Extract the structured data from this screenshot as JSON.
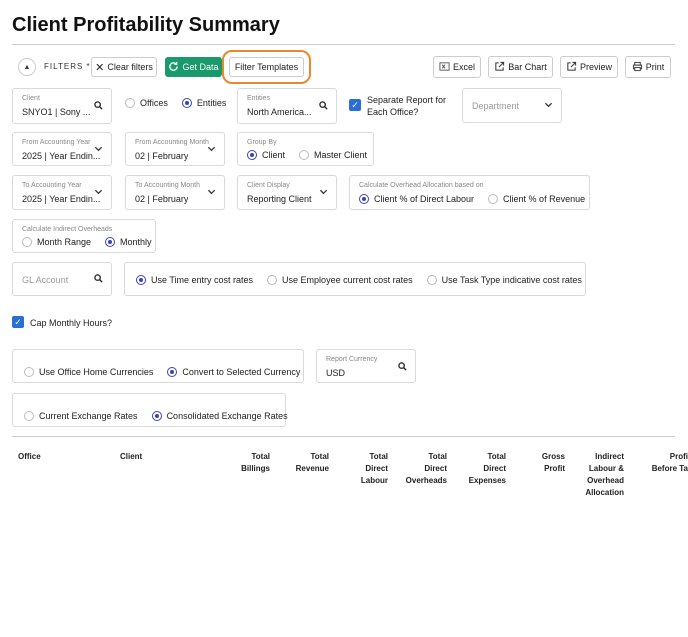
{
  "page": {
    "title": "Client Profitability Summary"
  },
  "toolbar": {
    "filters_label": "FILTERS *",
    "clear_filters": "Clear filters",
    "get_data": "Get Data",
    "filter_templates": "Filter Templates",
    "excel": "Excel",
    "bar_chart": "Bar Chart",
    "preview": "Preview",
    "print": "Print"
  },
  "filters": {
    "client": {
      "label": "Client",
      "value": "SNYO1 | Sony ..."
    },
    "scope": {
      "options": [
        "Offices",
        "Entities"
      ],
      "selected": "Entities"
    },
    "entities": {
      "label": "Entities",
      "value": "North America..."
    },
    "separate_report": {
      "label_line1": "Separate Report for",
      "label_line2": "Each Office?",
      "checked": true
    },
    "department": {
      "placeholder": "Department"
    },
    "from_year": {
      "label": "From Accounting Year",
      "value": "2025 | Year Endin..."
    },
    "from_month": {
      "label": "From Accounting Month",
      "value": "02 | February"
    },
    "group_by": {
      "label": "Group By",
      "options": [
        "Client",
        "Master Client"
      ],
      "selected": "Client"
    },
    "to_year": {
      "label": "To Accounting Year",
      "value": "2025 | Year Endin..."
    },
    "to_month": {
      "label": "To Accounting Month",
      "value": "02 | February"
    },
    "client_display": {
      "label": "Client Display",
      "value": "Reporting Client"
    },
    "overhead": {
      "label": "Calculate Overhead Allocation based on",
      "options": [
        "Client % of Direct Labour",
        "Client % of Revenue"
      ],
      "selected": "Client % of Direct Labour"
    },
    "indirect": {
      "label": "Calculate Indirect Overheads",
      "options": [
        "Month Range",
        "Monthly"
      ],
      "selected": "Monthly"
    },
    "gl_account": {
      "placeholder": "GL Account"
    },
    "cost_rates": {
      "options": [
        "Use Time entry cost rates",
        "Use Employee current cost rates",
        "Use Task Type indicative cost rates"
      ],
      "selected": "Use Time entry cost rates"
    },
    "cap_monthly": {
      "label": "Cap Monthly Hours?",
      "checked": true
    },
    "currency_mode": {
      "options": [
        "Use Office Home Currencies",
        "Convert to Selected Currency"
      ],
      "selected": "Convert to Selected Currency"
    },
    "report_currency": {
      "label": "Report Currency",
      "value": "USD"
    },
    "exchange_rates": {
      "options": [
        "Current Exchange Rates",
        "Consolidated Exchange Rates"
      ],
      "selected": "Consolidated Exchange Rates"
    }
  },
  "table": {
    "headers": [
      [
        "Office"
      ],
      [
        "Client"
      ],
      [
        "Total",
        "Billings"
      ],
      [
        "Total",
        "Revenue"
      ],
      [
        "Total",
        "Direct",
        "Labour"
      ],
      [
        "Total",
        "Direct",
        "Overheads"
      ],
      [
        "Total",
        "Direct",
        "Expenses"
      ],
      [
        "Gross",
        "Profit"
      ],
      [
        "Indirect",
        "Labour &",
        "Overhead",
        "Allocation"
      ],
      [
        "Profi",
        "Before Ta"
      ]
    ]
  },
  "colors": {
    "accent_green": "#1a9a6c",
    "radio_blue": "#3944bc",
    "checkbox_blue": "#2a6fd6",
    "highlight_orange": "#e8892b"
  }
}
